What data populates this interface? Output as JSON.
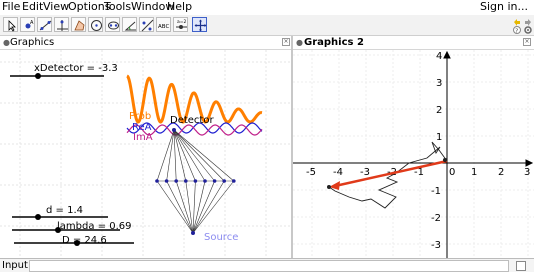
{
  "menubar": {
    "items": [
      "File",
      "Edit",
      "View",
      "Options",
      "Tools",
      "Window",
      "Help"
    ],
    "signin": "Sign in..."
  },
  "toolbar": {
    "tools": [
      "move-tool",
      "point-tool",
      "line-tool",
      "perpendicular-tool",
      "polygon-tool",
      "circle-tool",
      "ellipse-tool",
      "angle-tool",
      "reflect-tool",
      "slider-tool",
      "checkbox-tool",
      "move-view-tool"
    ],
    "selected": "move-view-tool"
  },
  "panels": {
    "graphics1_title": "Graphics",
    "graphics2_title": "Graphics 2"
  },
  "graphics1": {
    "sliders": {
      "xdetector": "xDetector = -3.3",
      "d": "d = 1.4",
      "lambda": "lambda = 0.69",
      "D": "D = 24.6"
    },
    "labels": {
      "prob": "Prob",
      "rea": "ReA",
      "ima": "ImA",
      "detector": "Detector",
      "source": "Source"
    },
    "colors": {
      "prob": "#ff7f00",
      "rea": "#1f1fd0",
      "ima": "#c0208a",
      "lines": "#333333",
      "points": "#20209a",
      "source": "#8c8cf0"
    }
  },
  "graphics2": {
    "x_ticks": [
      "-5",
      "-4",
      "-3",
      "-2",
      "-1",
      "0",
      "1",
      "2",
      "3"
    ],
    "y_ticks": [
      "4",
      "3",
      "2",
      "1",
      "-1",
      "-2",
      "-3"
    ],
    "arrow_color": "#e03a1a"
  },
  "inputbar": {
    "label": "Input:"
  }
}
